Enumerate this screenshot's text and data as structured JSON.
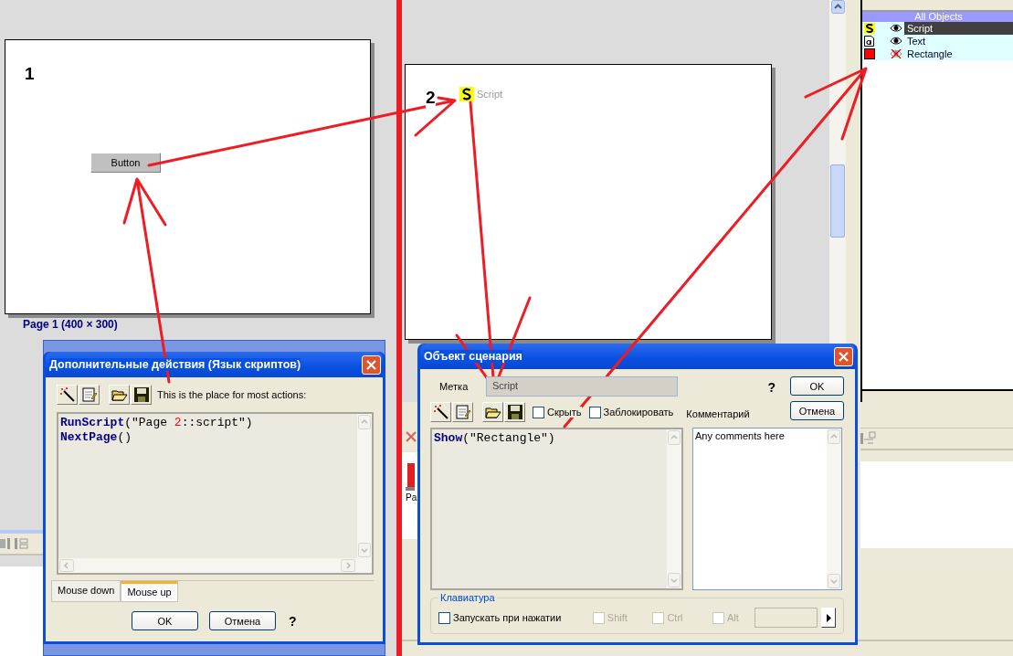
{
  "page1": {
    "number": "1",
    "button": "Button",
    "caption": "Page 1 (400 × 300)"
  },
  "page2": {
    "number": "2",
    "script_label": "Script"
  },
  "objects_panel": {
    "title": "All Objects",
    "items": [
      {
        "name": "Script",
        "kind": "script",
        "visible": true,
        "selected": true
      },
      {
        "name": "Text",
        "kind": "text",
        "visible": true,
        "selected": false
      },
      {
        "name": "Rectangle",
        "kind": "rectangle",
        "visible": false,
        "selected": false
      }
    ]
  },
  "background_fragment": "Pa",
  "actions_dialog": {
    "title": "Дополнительные действия (Язык скриптов)",
    "hint": "This is the place for most actions:",
    "code": [
      [
        {
          "kind": "keyword",
          "text": "RunScript"
        },
        {
          "kind": "plain",
          "text": "(\"Page "
        },
        {
          "kind": "number",
          "text": "2"
        },
        {
          "kind": "plain",
          "text": "::script\")"
        }
      ],
      [
        {
          "kind": "keyword",
          "text": "NextPage"
        },
        {
          "kind": "plain",
          "text": "()"
        }
      ]
    ],
    "tabs": [
      {
        "label": "Mouse down",
        "selected": false
      },
      {
        "label": "Mouse up",
        "selected": true
      }
    ],
    "buttons": [
      "OK",
      "Отмена"
    ],
    "help": "?"
  },
  "script_dialog": {
    "title": "Объект сценария",
    "label_caption": "Метка",
    "label_value": "Script",
    "help": "?",
    "buttons": [
      "OK",
      "Отмена"
    ],
    "hide": {
      "label": "Скрыть",
      "checked": false
    },
    "lock": {
      "label": "Заблокировать",
      "checked": false
    },
    "comment_caption": "Комментарий",
    "code": [
      [
        {
          "kind": "keyword",
          "text": "Show"
        },
        {
          "kind": "plain",
          "text": "(\"Rectangle\")"
        }
      ]
    ],
    "comment": "Any comments here",
    "keyboard": {
      "title": "Клавиатура",
      "run_on_press": {
        "label": "Запускать при нажатии",
        "checked": false
      },
      "modifiers": [
        {
          "label": "Shift",
          "checked": false,
          "disabled": true
        },
        {
          "label": "Ctrl",
          "checked": false,
          "disabled": true
        },
        {
          "label": "Alt",
          "checked": false,
          "disabled": true
        }
      ]
    }
  }
}
